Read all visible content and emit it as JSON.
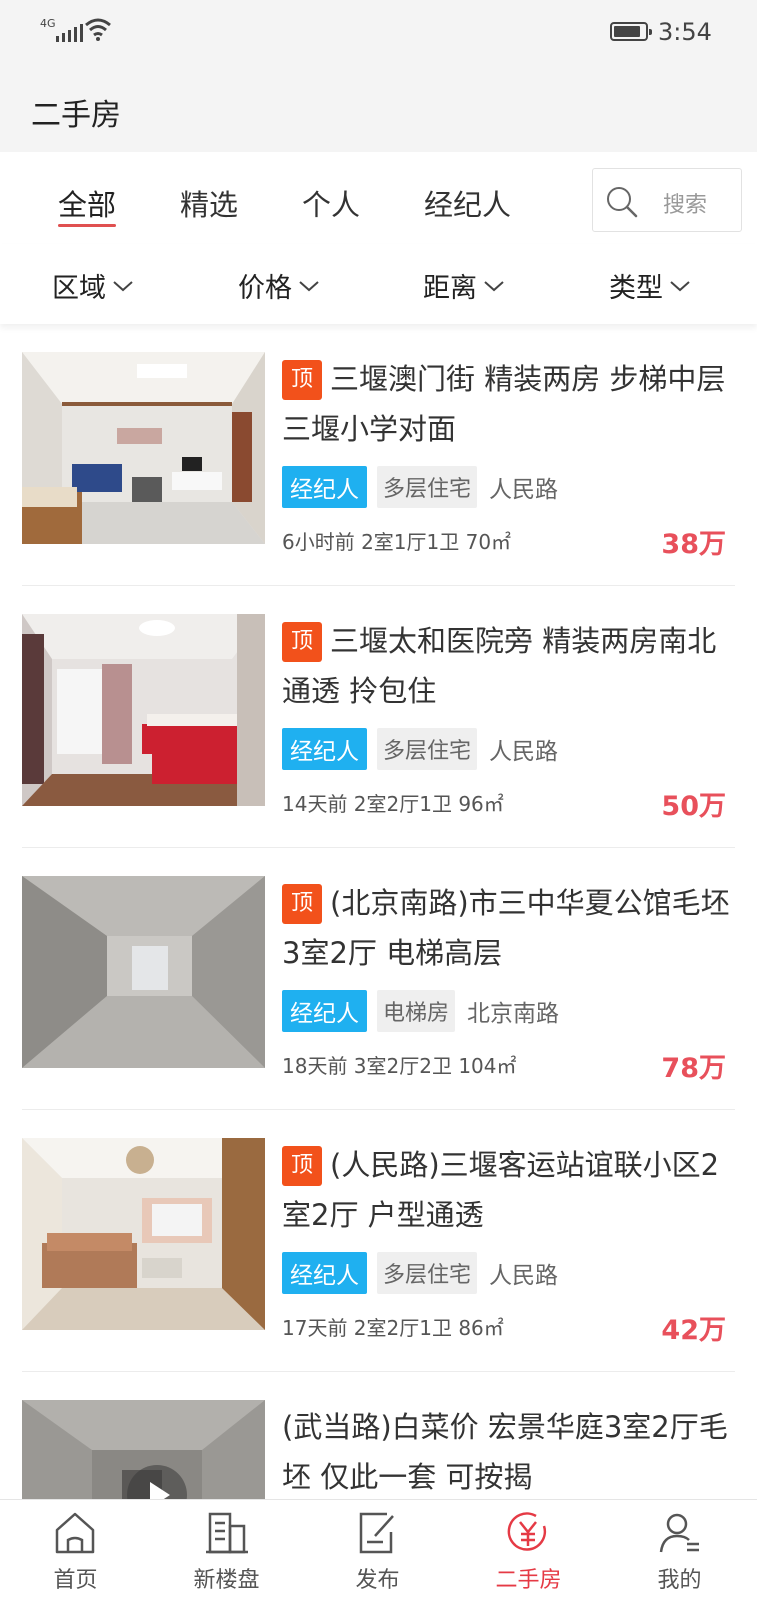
{
  "status_bar": {
    "network": "4G",
    "time": "3:54"
  },
  "header": {
    "title": "二手房"
  },
  "tabs": [
    {
      "label": "全部",
      "active": true
    },
    {
      "label": "精选",
      "active": false
    },
    {
      "label": "个人",
      "active": false
    },
    {
      "label": "经纪人",
      "active": false
    }
  ],
  "search": {
    "placeholder": "搜索"
  },
  "filters": [
    {
      "label": "区域"
    },
    {
      "label": "价格"
    },
    {
      "label": "距离"
    },
    {
      "label": "类型"
    }
  ],
  "listings": [
    {
      "top": true,
      "top_label": "顶",
      "title": "三堰澳门街 精装两房 步梯中层 三堰小学对面",
      "agent_tag": "经纪人",
      "type_tag": "多层住宅",
      "area_tag": "人民路",
      "meta": "6小时前 2室1厅1卫 70㎡",
      "price": "38万",
      "image": "living-room-photo"
    },
    {
      "top": true,
      "top_label": "顶",
      "title": "三堰太和医院旁 精装两房南北通透 拎包住",
      "agent_tag": "经纪人",
      "type_tag": "多层住宅",
      "area_tag": "人民路",
      "meta": "14天前 2室2厅1卫 96㎡",
      "price": "50万",
      "image": "bedroom-photo"
    },
    {
      "top": true,
      "top_label": "顶",
      "title": "(北京南路)市三中华夏公馆毛坯3室2厅 电梯高层",
      "agent_tag": "经纪人",
      "type_tag": "电梯房",
      "area_tag": "北京南路",
      "meta": "18天前 3室2厅2卫 104㎡",
      "price": "78万",
      "image": "concrete-room-photo"
    },
    {
      "top": true,
      "top_label": "顶",
      "title": "(人民路)三堰客运站谊联小区2室2厅 户型通透",
      "agent_tag": "经纪人",
      "type_tag": "多层住宅",
      "area_tag": "人民路",
      "meta": "17天前 2室2厅1卫 86㎡",
      "price": "42万",
      "image": "sofa-living-room-photo"
    },
    {
      "top": false,
      "top_label": "",
      "title": "(武当路)白菜价 宏景华庭3室2厅毛坯 仅此一套 可按揭",
      "agent_tag": "",
      "type_tag": "",
      "area_tag": "",
      "meta": "",
      "price": "",
      "image": "concrete-video-photo"
    }
  ],
  "bottom_nav": [
    {
      "label": "首页",
      "icon": "home-icon",
      "active": false
    },
    {
      "label": "新楼盘",
      "icon": "building-icon",
      "active": false
    },
    {
      "label": "发布",
      "icon": "publish-icon",
      "active": false
    },
    {
      "label": "二手房",
      "icon": "yuan-icon",
      "active": true
    },
    {
      "label": "我的",
      "icon": "profile-icon",
      "active": false
    }
  ],
  "colors": {
    "accent": "#e53a45",
    "top_badge": "#f2511b",
    "agent_tag": "#1fb0f0",
    "price": "#e8505b"
  }
}
